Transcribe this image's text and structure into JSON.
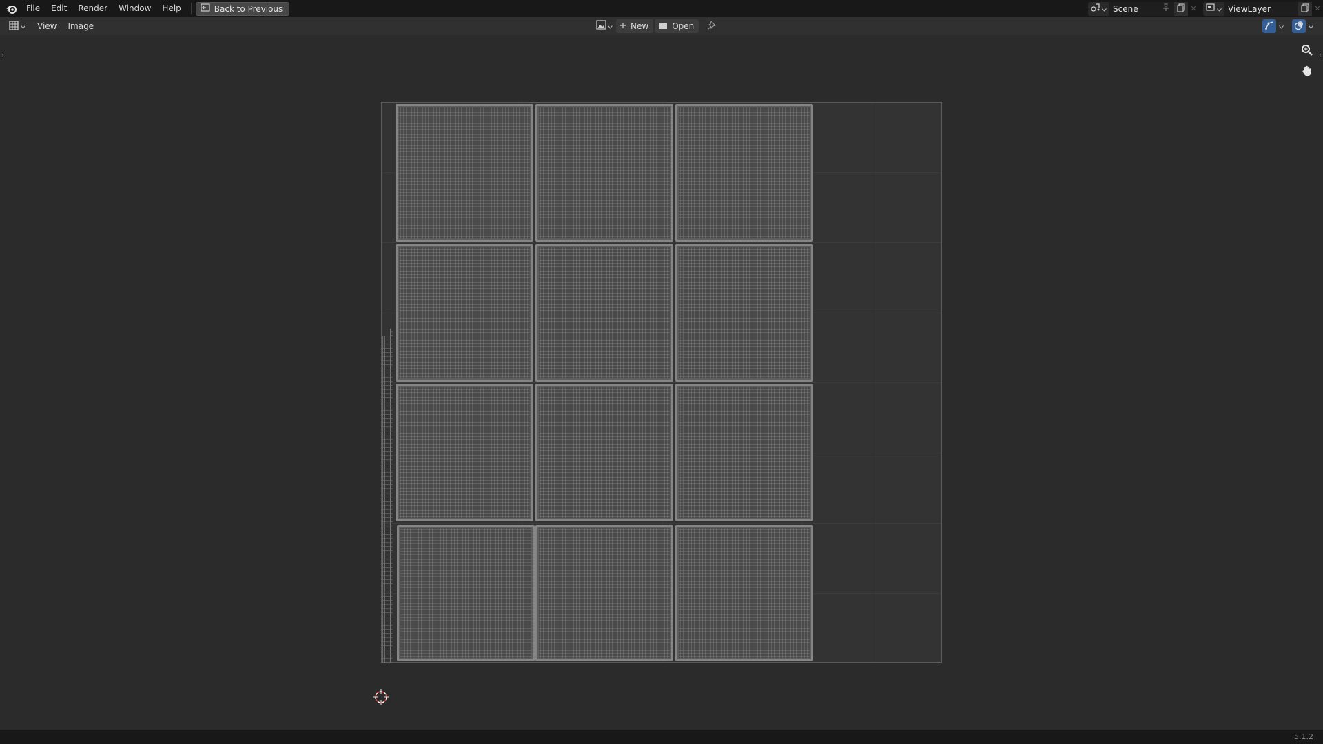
{
  "menubar": {
    "items": [
      "File",
      "Edit",
      "Render",
      "Window",
      "Help"
    ],
    "back_button": "Back to Previous"
  },
  "topright": {
    "scene_name": "Scene",
    "view_layer_name": "ViewLayer"
  },
  "editor_header": {
    "menus": [
      "View",
      "Image"
    ],
    "new_label": "New",
    "open_label": "Open"
  },
  "uv_grid": {
    "columns": 3,
    "rows": 4
  },
  "statusbar": {
    "version": "5.1.2"
  },
  "colors": {
    "accent_blue": "#335f96",
    "cursor_red": "#e04040",
    "island_edge": "#858585"
  },
  "icons": {
    "app": "blender-logo-icon",
    "back": "back-to-previous-icon",
    "scene": "scene-icon",
    "view_layer": "view-layer-icon",
    "image_browse": "image-browse-icon",
    "new": "plus-icon",
    "open": "folder-icon",
    "pin": "pin-icon",
    "gizmo": "gizmo-icon",
    "overlay": "overlay-icon",
    "zoom": "zoom-icon",
    "pan": "hand-icon"
  }
}
